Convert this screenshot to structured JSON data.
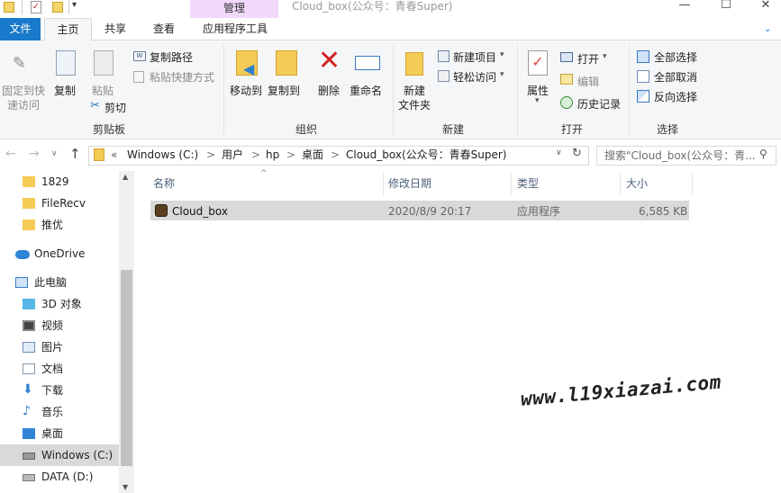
{
  "window": {
    "context_tab_group": "管理",
    "title": "Cloud_box(公众号：青春Super)",
    "minimize_label": "—",
    "maximize_label": "☐",
    "close_label": "✕"
  },
  "tabs": [
    "文件",
    "主页",
    "共享",
    "查看",
    "应用程序工具"
  ],
  "ribbon": {
    "clipboard": {
      "pin": "固定到快",
      "pin2": "速访问",
      "copy": "复制",
      "paste": "粘贴",
      "copy_path": "复制路径",
      "paste_shortcut": "粘贴快捷方式",
      "cut": "剪切",
      "group": "剪贴板"
    },
    "organize": {
      "move_to": "移动到",
      "copy_to": "复制到",
      "delete": "删除",
      "rename": "重命名",
      "group": "组织"
    },
    "new": {
      "new_folder": "新建",
      "new_folder2": "文件夹",
      "new_item": "新建项目",
      "easy_access": "轻松访问",
      "group": "新建"
    },
    "open": {
      "properties": "属性",
      "open": "打开",
      "edit": "编辑",
      "history": "历史记录",
      "group": "打开"
    },
    "select": {
      "select_all": "全部选择",
      "select_none": "全部取消",
      "invert": "反向选择",
      "group": "选择"
    }
  },
  "address": {
    "prefix": "«",
    "crumbs": [
      "Windows (C:)",
      "用户",
      "hp",
      "桌面",
      "Cloud_box(公众号：青春Super)"
    ],
    "sep": ">",
    "search_placeholder": "搜索\"Cloud_box(公众号：青..."
  },
  "nav": [
    "1829",
    "FileRecv",
    "推优",
    "OneDrive",
    "此电脑",
    "3D 对象",
    "视频",
    "图片",
    "文档",
    "下载",
    "音乐",
    "桌面",
    "Windows (C:)",
    "DATA (D:)"
  ],
  "columns": {
    "name": "名称",
    "date": "修改日期",
    "type": "类型",
    "size": "大小"
  },
  "files": [
    {
      "name": "Cloud_box",
      "date": "2020/8/9 20:17",
      "type": "应用程序",
      "size": "6,585 KB"
    }
  ],
  "watermark": "www.l19xiazai.com"
}
